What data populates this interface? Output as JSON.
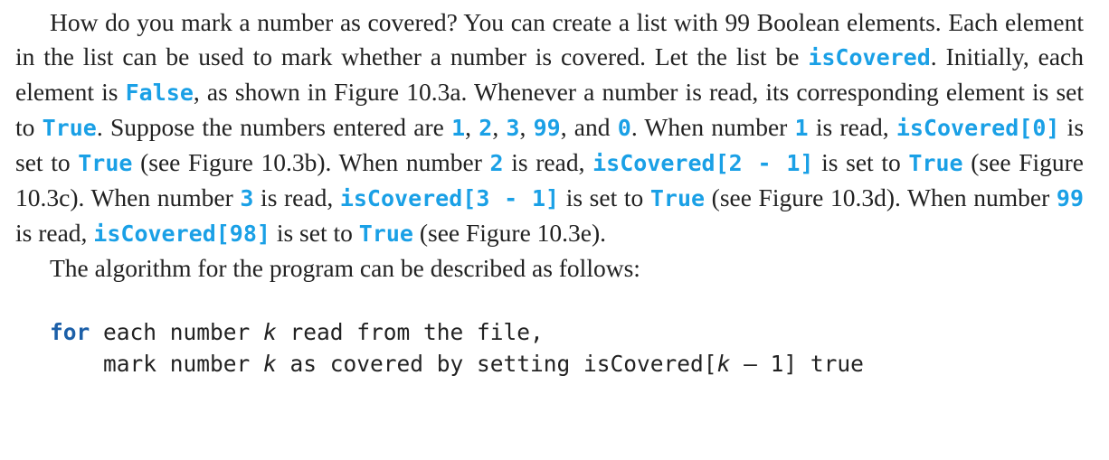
{
  "paragraph1": {
    "t01": "How do you mark a number as covered? You can create a list with 99 Boolean elements. Each element in the list can be used to mark whether a number is covered. Let the list be ",
    "c01": "isCovered",
    "t02": ". Initially, each element is ",
    "c02": "False",
    "t03": ", as shown in Figure 10.3a. Whenever a number is read, its corresponding element is set to ",
    "c03": "True",
    "t04": ". Suppose the numbers entered are ",
    "c04": "1",
    "t05": ", ",
    "c05": "2",
    "t06": ", ",
    "c06": "3",
    "t07": ", ",
    "c07": "99",
    "t08": ", and ",
    "c08": "0",
    "t09": ". When number ",
    "c09": "1",
    "t10": " is read, ",
    "c10": "isCovered[0]",
    "t11": " is set to ",
    "c11": "True",
    "t12": " (see Figure 10.3b). When num­ber ",
    "c12": "2",
    "t13": " is read, ",
    "c13": "isCovered[2 - 1]",
    "t14": " is set to ",
    "c14": "True",
    "t15": " (see Figure 10.3c). When number ",
    "c15": "3",
    "t16": " is read, ",
    "c16": "isCovered[3 - 1]",
    "t17": " is set to ",
    "c17": "True",
    "t18": " (see Figure 10.3d). When number ",
    "c18": "99",
    "t19": " is read, ",
    "c19": "isCovered[98]",
    "t20": " is set to ",
    "c20": "True",
    "t21": " (see Figure 10.3e)."
  },
  "paragraph2": {
    "text": "The algorithm for the program can be described as follows:"
  },
  "algorithm": {
    "line1": {
      "keyword": "for",
      "part1": " each number ",
      "var": "k",
      "part2": " read from the file,"
    },
    "line2": {
      "indent": "    ",
      "part1": "mark number ",
      "var1": "k",
      "part2": " as covered by setting isCovered[",
      "var2": "k",
      "part3": " – 1] true"
    }
  }
}
